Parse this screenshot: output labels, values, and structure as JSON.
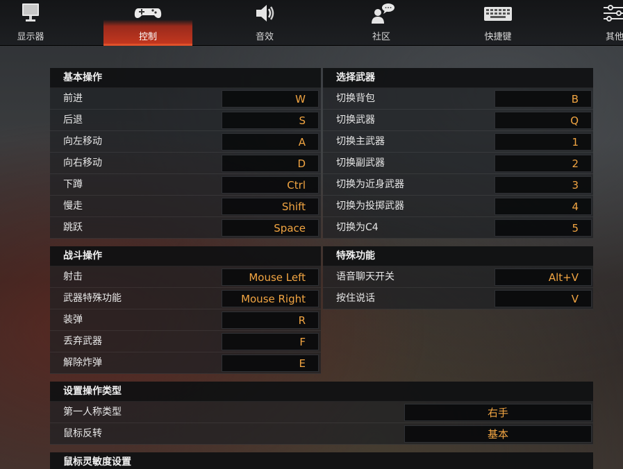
{
  "nav": {
    "tabs": [
      {
        "label": "显示器",
        "icon": "monitor-icon",
        "active": false
      },
      {
        "label": "控制",
        "icon": "gamepad-icon",
        "active": true
      },
      {
        "label": "音效",
        "icon": "speaker-icon",
        "active": false
      },
      {
        "label": "社区",
        "icon": "community-icon",
        "active": false
      },
      {
        "label": "快捷键",
        "icon": "keyboard-icon",
        "active": false
      },
      {
        "label": "其他",
        "icon": "sliders-icon",
        "active": false
      }
    ]
  },
  "basic": {
    "title": "基本操作",
    "rows": [
      {
        "label": "前进",
        "key": "W"
      },
      {
        "label": "后退",
        "key": "S"
      },
      {
        "label": "向左移动",
        "key": "A"
      },
      {
        "label": "向右移动",
        "key": "D"
      },
      {
        "label": "下蹲",
        "key": "Ctrl"
      },
      {
        "label": "慢走",
        "key": "Shift"
      },
      {
        "label": "跳跃",
        "key": "Space"
      }
    ]
  },
  "weapons": {
    "title": "选择武器",
    "rows": [
      {
        "label": "切换背包",
        "key": "B"
      },
      {
        "label": "切换武器",
        "key": "Q"
      },
      {
        "label": "切换主武器",
        "key": "1"
      },
      {
        "label": "切换副武器",
        "key": "2"
      },
      {
        "label": "切换为近身武器",
        "key": "3"
      },
      {
        "label": "切换为投掷武器",
        "key": "4"
      },
      {
        "label": "切换为C4",
        "key": "5"
      }
    ]
  },
  "combat": {
    "title": "战斗操作",
    "rows": [
      {
        "label": "射击",
        "key": "Mouse Left"
      },
      {
        "label": "武器特殊功能",
        "key": "Mouse Right"
      },
      {
        "label": "装弹",
        "key": "R"
      },
      {
        "label": "丢弃武器",
        "key": "F"
      },
      {
        "label": "解除炸弹",
        "key": "E"
      }
    ]
  },
  "special": {
    "title": "特殊功能",
    "rows": [
      {
        "label": "语音聊天开关",
        "key": "Alt+V"
      },
      {
        "label": "按住说话",
        "key": "V"
      }
    ]
  },
  "optype": {
    "title": "设置操作类型",
    "rows": [
      {
        "label": "第一人称类型",
        "value": "右手"
      },
      {
        "label": "鼠标反转",
        "value": "基本"
      }
    ]
  },
  "sensitivity": {
    "title": "鼠标灵敏度设置"
  },
  "colors": {
    "accent": "#c2371f",
    "keyText": "#f2a542"
  }
}
